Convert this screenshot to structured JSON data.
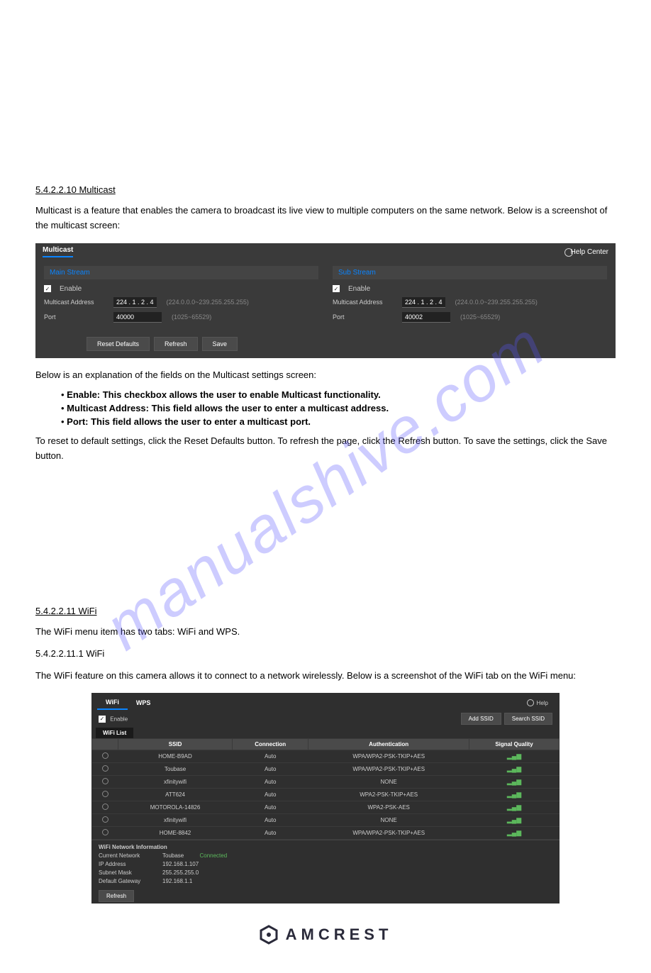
{
  "watermark": "manualshive.com",
  "section1": {
    "heading": "5.4.2.2.10 Multicast",
    "intro": "Multicast is a feature that enables the camera to broadcast its live view to multiple computers on the same network. Below is a screenshot of the multicast screen:",
    "desc": "Below is an explanation of the fields on the Multicast settings screen:",
    "bullets": [
      "Enable: This checkbox allows the user to enable Multicast functionality.",
      "Multicast Address: This field allows the user to enter a multicast address.",
      "Port: This field allows the user to enter a multicast port."
    ],
    "footer": "To reset to default settings, click the Reset Defaults button. To refresh the page, click the Refresh button. To save the settings, click the Save button."
  },
  "multicast": {
    "title": "Multicast",
    "help": "Help Center",
    "main": {
      "label": "Main Stream",
      "enable": "Enable",
      "addr_label": "Multicast Address",
      "addr": "224 .  1  .  2  .  4",
      "addr_hint": "(224.0.0.0~239.255.255.255)",
      "port_label": "Port",
      "port": "40000",
      "port_hint": "(1025~65529)"
    },
    "sub": {
      "label": "Sub Stream",
      "enable": "Enable",
      "addr_label": "Multicast Address",
      "addr": "224 .  1  .  2  .  4",
      "addr_hint": "(224.0.0.0~239.255.255.255)",
      "port_label": "Port",
      "port": "40002",
      "port_hint": "(1025~65529)"
    },
    "buttons": {
      "reset": "Reset Defaults",
      "refresh": "Refresh",
      "save": "Save"
    }
  },
  "section2": {
    "heading": "5.4.2.2.11 WiFi",
    "intro": "The WiFi menu item has two tabs: WiFi and WPS.",
    "sub": "5.4.2.2.11.1 WiFi",
    "desc": "The WiFi feature on this camera allows it to connect to a network wirelessly. Below is a screenshot of the WiFi tab on the WiFi menu:"
  },
  "wifi": {
    "tabs": {
      "wifi": "WiFi",
      "wps": "WPS"
    },
    "help": "Help",
    "enable": "Enable",
    "add": "Add SSID",
    "search": "Search SSID",
    "list_label": "WiFi List",
    "headers": {
      "ssid": "SSID",
      "conn": "Connection",
      "auth": "Authentication",
      "sig": "Signal Quality"
    },
    "rows": [
      {
        "ssid": "HOME-B9AD",
        "conn": "Auto",
        "auth": "WPA/WPA2-PSK-TKIP+AES"
      },
      {
        "ssid": "Toubase",
        "conn": "Auto",
        "auth": "WPA/WPA2-PSK-TKIP+AES"
      },
      {
        "ssid": "xfinitywifi",
        "conn": "Auto",
        "auth": "NONE"
      },
      {
        "ssid": "ATT624",
        "conn": "Auto",
        "auth": "WPA2-PSK-TKIP+AES"
      },
      {
        "ssid": "MOTOROLA-14826",
        "conn": "Auto",
        "auth": "WPA2-PSK-AES"
      },
      {
        "ssid": "xfinitywifi",
        "conn": "Auto",
        "auth": "NONE"
      },
      {
        "ssid": "HOME-8842",
        "conn": "Auto",
        "auth": "WPA/WPA2-PSK-TKIP+AES"
      }
    ],
    "info": {
      "title": "WiFi Network Information",
      "net_label": "Current Network",
      "net": "Toubase",
      "status": "Connected",
      "ip_label": "IP Address",
      "ip": "192.168.1.107",
      "mask_label": "Subnet Mask",
      "mask": "255.255.255.0",
      "gw_label": "Default Gateway",
      "gw": "192.168.1.1"
    },
    "refresh": "Refresh"
  },
  "brand": "AMCREST"
}
